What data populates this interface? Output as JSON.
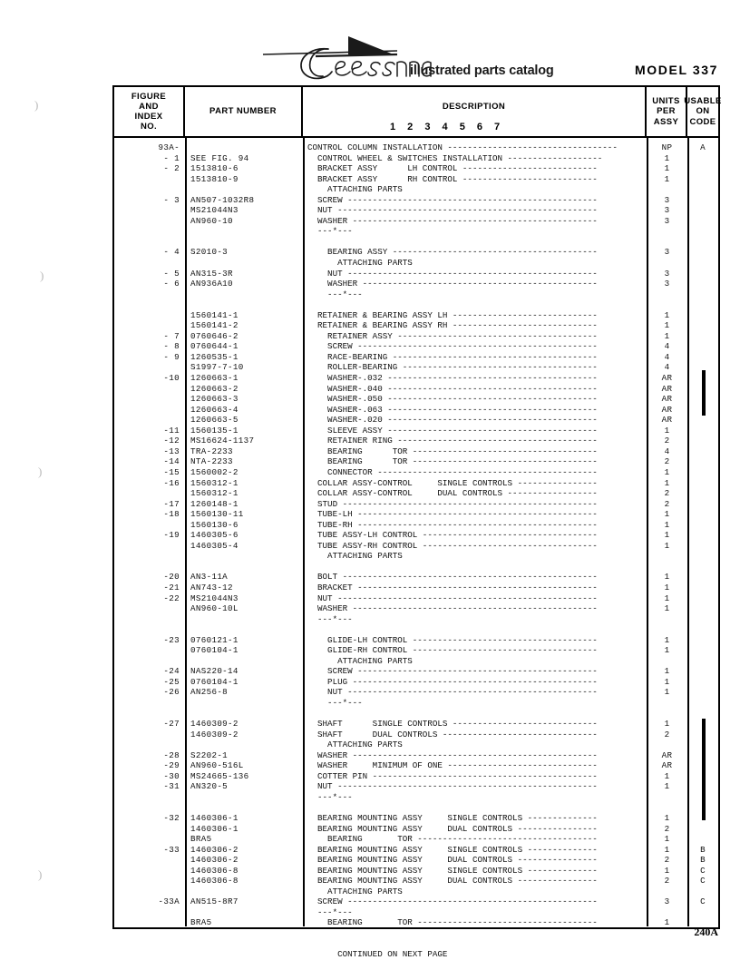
{
  "header": {
    "brand": "Cessna",
    "tagline": "illustrated parts catalog",
    "model": "MODEL  337",
    "logo_icon": "cessna-script-logo"
  },
  "table": {
    "columns": {
      "figure_index": "FIGURE\nAND\nINDEX\nNO.",
      "part_number": "PART  NUMBER",
      "description": "DESCRIPTION",
      "description_indent_guide": "1 2 3 4 5 6 7",
      "units_per_assy": "UNITS\nPER\nASSY",
      "usable_on_code": "USABLE\nON\nCODE"
    },
    "rows": [
      {
        "fig": "93A-",
        "part": "",
        "desc": "CONTROL COLUMN INSTALLATION ----------------------------------",
        "units": "NP",
        "code": "A"
      },
      {
        "fig": "- 1",
        "part": "SEE FIG. 94",
        "desc": "  CONTROL WHEEL & SWITCHES INSTALLATION -------------------",
        "units": "1",
        "code": ""
      },
      {
        "fig": "- 2",
        "part": "1513810-6",
        "desc": "  BRACKET ASSY      LH CONTROL ---------------------------",
        "units": "1",
        "code": ""
      },
      {
        "fig": "",
        "part": "1513810-9",
        "desc": "  BRACKET ASSY      RH CONTROL ---------------------------",
        "units": "1",
        "code": ""
      },
      {
        "fig": "",
        "part": "",
        "desc": "    ATTACHING PARTS",
        "units": "",
        "code": ""
      },
      {
        "fig": "- 3",
        "part": "AN507-1032R8",
        "desc": "  SCREW --------------------------------------------------",
        "units": "3",
        "code": ""
      },
      {
        "fig": "",
        "part": "MS21044N3",
        "desc": "  NUT ----------------------------------------------------",
        "units": "3",
        "code": ""
      },
      {
        "fig": "",
        "part": "AN960-10",
        "desc": "  WASHER -------------------------------------------------",
        "units": "3",
        "code": ""
      },
      {
        "fig": "",
        "part": "",
        "desc": "  ---*---",
        "units": "",
        "code": ""
      },
      {
        "fig": "",
        "part": "",
        "desc": "",
        "units": "",
        "code": ""
      },
      {
        "fig": "- 4",
        "part": "S2010-3",
        "desc": "    BEARING ASSY -----------------------------------------",
        "units": "3",
        "code": ""
      },
      {
        "fig": "",
        "part": "",
        "desc": "      ATTACHING PARTS",
        "units": "",
        "code": ""
      },
      {
        "fig": "- 5",
        "part": "AN315-3R",
        "desc": "    NUT --------------------------------------------------",
        "units": "3",
        "code": ""
      },
      {
        "fig": "- 6",
        "part": "AN936A10",
        "desc": "    WASHER -----------------------------------------------",
        "units": "3",
        "code": ""
      },
      {
        "fig": "",
        "part": "",
        "desc": "    ---*---",
        "units": "",
        "code": ""
      },
      {
        "fig": "",
        "part": "",
        "desc": "",
        "units": "",
        "code": ""
      },
      {
        "fig": "",
        "part": "1560141-1",
        "desc": "  RETAINER & BEARING ASSY LH -----------------------------",
        "units": "1",
        "code": ""
      },
      {
        "fig": "",
        "part": "1560141-2",
        "desc": "  RETAINER & BEARING ASSY RH -----------------------------",
        "units": "1",
        "code": ""
      },
      {
        "fig": "- 7",
        "part": "0760646-2",
        "desc": "    RETAINER ASSY ----------------------------------------",
        "units": "1",
        "code": ""
      },
      {
        "fig": "- 8",
        "part": "0760644-1",
        "desc": "    SCREW ------------------------------------------------",
        "units": "4",
        "code": ""
      },
      {
        "fig": "- 9",
        "part": "1260535-1",
        "desc": "    RACE-BEARING -----------------------------------------",
        "units": "4",
        "code": ""
      },
      {
        "fig": "",
        "part": "S1997-7-10",
        "desc": "    ROLLER-BEARING ---------------------------------------",
        "units": "4",
        "code": ""
      },
      {
        "fig": "-10",
        "part": "1260663-1",
        "desc": "    WASHER-.032 ------------------------------------------",
        "units": "AR",
        "code": ""
      },
      {
        "fig": "",
        "part": "1260663-2",
        "desc": "    WASHER-.040 ------------------------------------------",
        "units": "AR",
        "code": ""
      },
      {
        "fig": "",
        "part": "1260663-3",
        "desc": "    WASHER-.050 ------------------------------------------",
        "units": "AR",
        "code": ""
      },
      {
        "fig": "",
        "part": "1260663-4",
        "desc": "    WASHER-.063 ------------------------------------------",
        "units": "AR",
        "code": ""
      },
      {
        "fig": "",
        "part": "1260663-5",
        "desc": "    WASHER-.020 ------------------------------------------",
        "units": "AR",
        "code": ""
      },
      {
        "fig": "-11",
        "part": "1560135-1",
        "desc": "    SLEEVE ASSY ------------------------------------------",
        "units": "1",
        "code": ""
      },
      {
        "fig": "-12",
        "part": "MS16624-1137",
        "desc": "    RETAINER RING ----------------------------------------",
        "units": "2",
        "code": ""
      },
      {
        "fig": "-13",
        "part": "TRA-2233",
        "desc": "    BEARING      TOR -------------------------------------",
        "units": "4",
        "code": ""
      },
      {
        "fig": "-14",
        "part": "NTA-2233",
        "desc": "    BEARING      TOR -------------------------------------",
        "units": "2",
        "code": ""
      },
      {
        "fig": "-15",
        "part": "1560002-2",
        "desc": "    CONNECTOR --------------------------------------------",
        "units": "1",
        "code": ""
      },
      {
        "fig": "-16",
        "part": "1560312-1",
        "desc": "  COLLAR ASSY-CONTROL     SINGLE CONTROLS ----------------",
        "units": "1",
        "code": ""
      },
      {
        "fig": "",
        "part": "1560312-1",
        "desc": "  COLLAR ASSY-CONTROL     DUAL CONTROLS ------------------",
        "units": "2",
        "code": ""
      },
      {
        "fig": "-17",
        "part": "1260148-1",
        "desc": "  STUD ---------------------------------------------------",
        "units": "2",
        "code": ""
      },
      {
        "fig": "-18",
        "part": "1560130-11",
        "desc": "  TUBE-LH ------------------------------------------------",
        "units": "1",
        "code": ""
      },
      {
        "fig": "",
        "part": "1560130-6",
        "desc": "  TUBE-RH ------------------------------------------------",
        "units": "1",
        "code": ""
      },
      {
        "fig": "-19",
        "part": "1460305-6",
        "desc": "  TUBE ASSY-LH CONTROL -----------------------------------",
        "units": "1",
        "code": ""
      },
      {
        "fig": "",
        "part": "1460305-4",
        "desc": "  TUBE ASSY-RH CONTROL -----------------------------------",
        "units": "1",
        "code": ""
      },
      {
        "fig": "",
        "part": "",
        "desc": "    ATTACHING PARTS",
        "units": "",
        "code": ""
      },
      {
        "fig": "",
        "part": "",
        "desc": "",
        "units": "",
        "code": ""
      },
      {
        "fig": "-20",
        "part": "AN3-11A",
        "desc": "  BOLT ---------------------------------------------------",
        "units": "1",
        "code": ""
      },
      {
        "fig": "-21",
        "part": "AN743-12",
        "desc": "  BRACKET ------------------------------------------------",
        "units": "1",
        "code": ""
      },
      {
        "fig": "-22",
        "part": "MS21044N3",
        "desc": "  NUT ----------------------------------------------------",
        "units": "1",
        "code": ""
      },
      {
        "fig": "",
        "part": "AN960-10L",
        "desc": "  WASHER -------------------------------------------------",
        "units": "1",
        "code": ""
      },
      {
        "fig": "",
        "part": "",
        "desc": "  ---*---",
        "units": "",
        "code": ""
      },
      {
        "fig": "",
        "part": "",
        "desc": "",
        "units": "",
        "code": ""
      },
      {
        "fig": "-23",
        "part": "0760121-1",
        "desc": "    GLIDE-LH CONTROL -------------------------------------",
        "units": "1",
        "code": ""
      },
      {
        "fig": "",
        "part": "0760104-1",
        "desc": "    GLIDE-RH CONTROL -------------------------------------",
        "units": "1",
        "code": ""
      },
      {
        "fig": "",
        "part": "",
        "desc": "      ATTACHING PARTS",
        "units": "",
        "code": ""
      },
      {
        "fig": "-24",
        "part": "NAS220-14",
        "desc": "    SCREW ------------------------------------------------",
        "units": "1",
        "code": ""
      },
      {
        "fig": "-25",
        "part": "0760104-1",
        "desc": "    PLUG -------------------------------------------------",
        "units": "1",
        "code": ""
      },
      {
        "fig": "-26",
        "part": "AN256-8",
        "desc": "    NUT --------------------------------------------------",
        "units": "1",
        "code": ""
      },
      {
        "fig": "",
        "part": "",
        "desc": "    ---*---",
        "units": "",
        "code": ""
      },
      {
        "fig": "",
        "part": "",
        "desc": "",
        "units": "",
        "code": ""
      },
      {
        "fig": "-27",
        "part": "1460309-2",
        "desc": "  SHAFT      SINGLE CONTROLS -----------------------------",
        "units": "1",
        "code": ""
      },
      {
        "fig": "",
        "part": "1460309-2",
        "desc": "  SHAFT      DUAL CONTROLS -------------------------------",
        "units": "2",
        "code": ""
      },
      {
        "fig": "",
        "part": "",
        "desc": "    ATTACHING PARTS",
        "units": "",
        "code": ""
      },
      {
        "fig": "-28",
        "part": "S2202-1",
        "desc": "  WASHER -------------------------------------------------",
        "units": "AR",
        "code": ""
      },
      {
        "fig": "-29",
        "part": "AN960-516L",
        "desc": "  WASHER     MINIMUM OF ONE ------------------------------",
        "units": "AR",
        "code": ""
      },
      {
        "fig": "-30",
        "part": "MS24665-136",
        "desc": "  COTTER PIN ---------------------------------------------",
        "units": "1",
        "code": ""
      },
      {
        "fig": "-31",
        "part": "AN320-5",
        "desc": "  NUT ----------------------------------------------------",
        "units": "1",
        "code": ""
      },
      {
        "fig": "",
        "part": "",
        "desc": "  ---*---",
        "units": "",
        "code": ""
      },
      {
        "fig": "",
        "part": "",
        "desc": "",
        "units": "",
        "code": ""
      },
      {
        "fig": "-32",
        "part": "1460306-1",
        "desc": "  BEARING MOUNTING ASSY     SINGLE CONTROLS --------------",
        "units": "1",
        "code": ""
      },
      {
        "fig": "",
        "part": "1460306-1",
        "desc": "  BEARING MOUNTING ASSY     DUAL CONTROLS ----------------",
        "units": "2",
        "code": ""
      },
      {
        "fig": "",
        "part": "BRA5",
        "desc": "    BEARING       TOR ------------------------------------",
        "units": "1",
        "code": ""
      },
      {
        "fig": "-33",
        "part": "1460306-2",
        "desc": "  BEARING MOUNTING ASSY     SINGLE CONTROLS --------------",
        "units": "1",
        "code": "B"
      },
      {
        "fig": "",
        "part": "1460306-2",
        "desc": "  BEARING MOUNTING ASSY     DUAL CONTROLS ----------------",
        "units": "2",
        "code": "B"
      },
      {
        "fig": "",
        "part": "1460306-8",
        "desc": "  BEARING MOUNTING ASSY     SINGLE CONTROLS --------------",
        "units": "1",
        "code": "C"
      },
      {
        "fig": "",
        "part": "1460306-8",
        "desc": "  BEARING MOUNTING ASSY     DUAL CONTROLS ----------------",
        "units": "2",
        "code": "C"
      },
      {
        "fig": "",
        "part": "",
        "desc": "    ATTACHING PARTS",
        "units": "",
        "code": ""
      },
      {
        "fig": "-33A",
        "part": "AN515-8R7",
        "desc": "  SCREW --------------------------------------------------",
        "units": "3",
        "code": "C"
      },
      {
        "fig": "",
        "part": "",
        "desc": "  ---*---",
        "units": "",
        "code": ""
      },
      {
        "fig": "",
        "part": "BRA5",
        "desc": "    BEARING       TOR ------------------------------------",
        "units": "1",
        "code": ""
      },
      {
        "fig": "",
        "part": "",
        "desc": "",
        "units": "",
        "code": ""
      },
      {
        "fig": "",
        "part": "",
        "desc": "",
        "units": "",
        "code": ""
      },
      {
        "fig": "",
        "part": "",
        "desc": "      CONTINUED ON NEXT PAGE",
        "units": "",
        "code": ""
      }
    ]
  },
  "footer": {
    "page_number": "240A"
  }
}
